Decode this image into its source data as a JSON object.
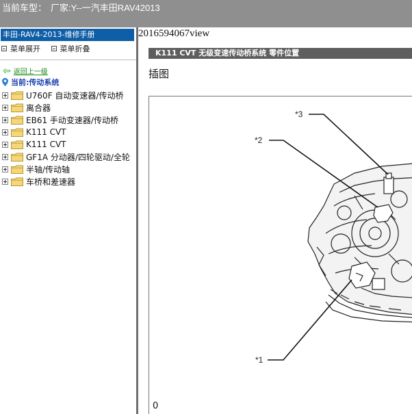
{
  "header": {
    "label": "当前车型：",
    "vehicle": "厂家:Y--一汽丰田RAV42013"
  },
  "sidebar": {
    "title": "丰田-RAV4-2013-维修手册",
    "expand_label": "菜单展开",
    "collapse_label": "菜单折叠",
    "back_label": "返回上一级",
    "current_label": "当前:传动系统",
    "items": [
      {
        "label": "U760F 自动变速器/传动桥"
      },
      {
        "label": "离合器"
      },
      {
        "label": "EB61 手动变速器/传动桥"
      },
      {
        "label": "K111 CVT"
      },
      {
        "label": "K111 CVT"
      },
      {
        "label": "GF1A 分动器/四轮驱动/全轮"
      },
      {
        "label": "半轴/传动轴"
      },
      {
        "label": "车桥和差速器"
      }
    ]
  },
  "main": {
    "view_id": "2016594067view",
    "doc_header": "K111 CVT  无级变速传动桥系统  零件位置",
    "section_title": "插图",
    "figure_number": "0",
    "callouts": [
      "*3",
      "*2",
      "*1"
    ]
  }
}
